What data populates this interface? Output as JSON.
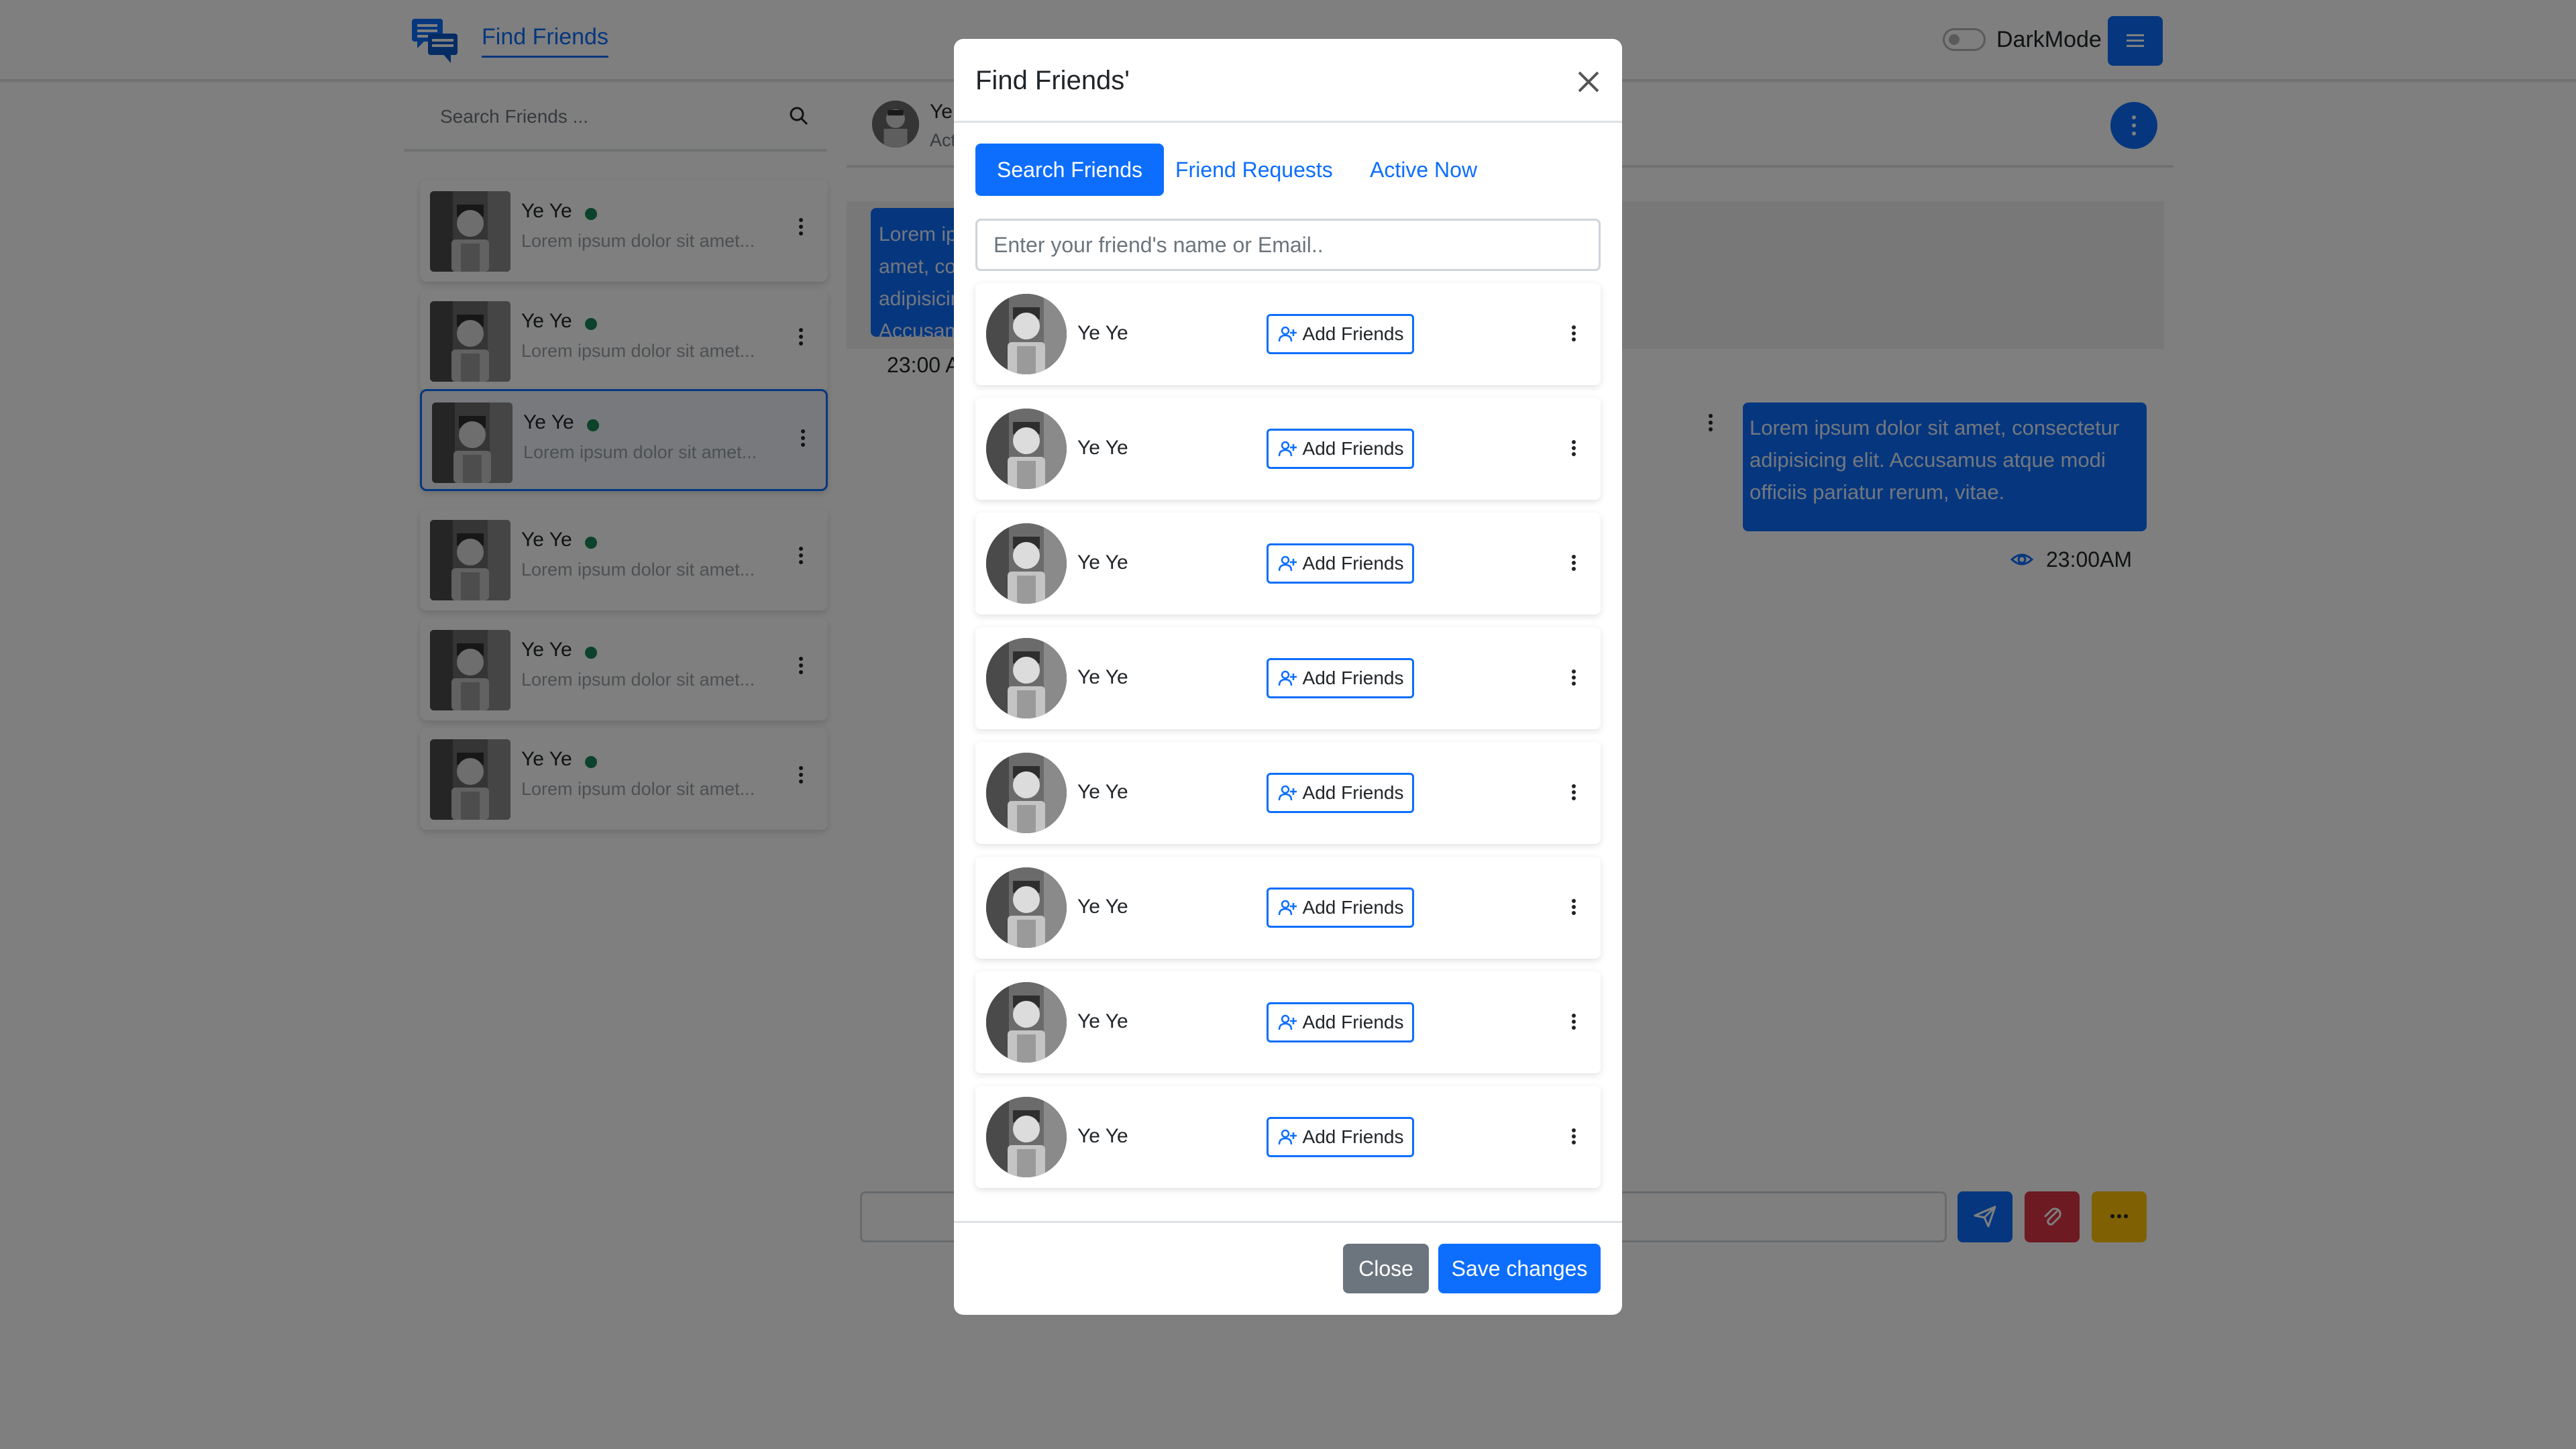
{
  "navbar": {
    "nav_link": "Find Friends",
    "dark_mode_label": "DarkMode"
  },
  "sidebar": {
    "search_placeholder": "Search Friends ...",
    "contacts": [
      {
        "name": "Ye Ye",
        "preview": "Lorem ipsum dolor sit amet...",
        "online": true,
        "active": false
      },
      {
        "name": "Ye Ye",
        "preview": "Lorem ipsum dolor sit amet...",
        "online": true,
        "active": false
      },
      {
        "name": "Ye Ye",
        "preview": "Lorem ipsum dolor sit amet...",
        "online": true,
        "active": true
      },
      {
        "name": "Ye Ye",
        "preview": "Lorem ipsum dolor sit amet...",
        "online": true,
        "active": false
      },
      {
        "name": "Ye Ye",
        "preview": "Lorem ipsum dolor sit amet...",
        "online": true,
        "active": false
      },
      {
        "name": "Ye Ye",
        "preview": "Lorem ipsum dolor sit amet...",
        "online": true,
        "active": false
      }
    ]
  },
  "chat": {
    "header_name": "Ye",
    "header_status": "Act",
    "left_message": "Lorem ipsum dolor sit amet, consectetur adipisicing elit. Accusamus atque modi officiis pariatur rerum, vitae.",
    "left_time": "23:00 AM",
    "right_message": "Lorem ipsum dolor sit amet, consectetur adipisicing elit. Accusamus atque modi officiis pariatur rerum, vitae.",
    "right_time": "23:00AM"
  },
  "modal": {
    "title": "Find Friends'",
    "tabs": [
      {
        "label": "Search Friends",
        "active": true
      },
      {
        "label": "Friend Requests",
        "active": false
      },
      {
        "label": "Active Now",
        "active": false
      }
    ],
    "input_placeholder": "Enter your friend's name or Email..",
    "friends": [
      {
        "name": "Ye Ye",
        "button": "Add Friends"
      },
      {
        "name": "Ye Ye",
        "button": "Add Friends"
      },
      {
        "name": "Ye Ye",
        "button": "Add Friends"
      },
      {
        "name": "Ye Ye",
        "button": "Add Friends"
      },
      {
        "name": "Ye Ye",
        "button": "Add Friends"
      },
      {
        "name": "Ye Ye",
        "button": "Add Friends"
      },
      {
        "name": "Ye Ye",
        "button": "Add Friends"
      },
      {
        "name": "Ye Ye",
        "button": "Add Friends"
      }
    ],
    "close_label": "Close",
    "save_label": "Save changes"
  },
  "colors": {
    "primary": "#0d6efd",
    "online": "#198754",
    "danger": "#dc3545",
    "warning": "#ffc107",
    "secondary": "#6c757d"
  },
  "icons": [
    "chat-logo-icon",
    "hamburger-menu-icon",
    "search-icon",
    "kebab-icon",
    "close-icon",
    "add-user-icon",
    "send-icon",
    "paperclip-icon",
    "ellipsis-icon",
    "eye-icon"
  ]
}
